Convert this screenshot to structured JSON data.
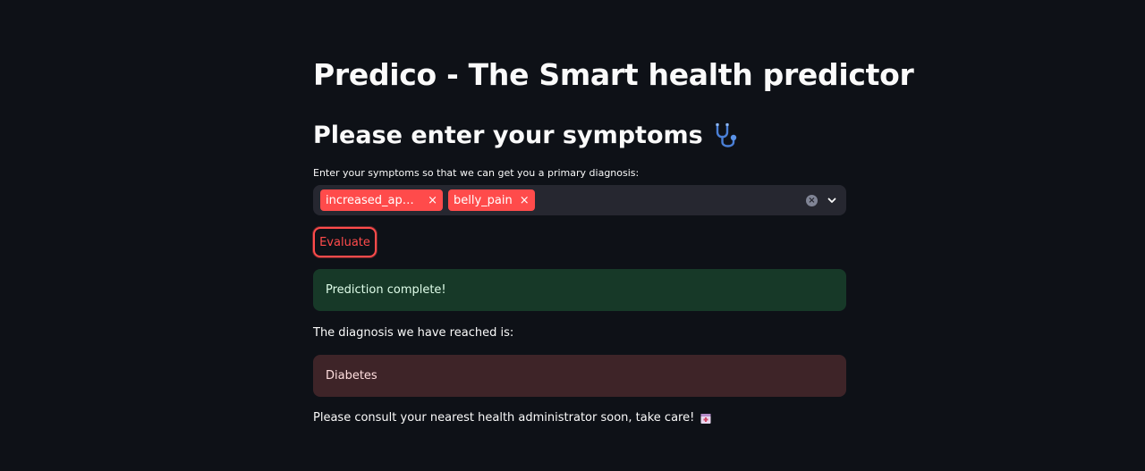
{
  "app": {
    "title": "Predico - The Smart health predictor"
  },
  "form": {
    "heading": "Please enter your symptoms",
    "heading_icon": "stethoscope-icon",
    "label": "Enter your symptoms so that we can get you a primary diagnosis:",
    "selected_symptoms": [
      {
        "label": "increased_appet...",
        "remove": "×"
      },
      {
        "label": "belly_pain",
        "remove": "×"
      }
    ],
    "tag_color": "#ff4b4b",
    "clear_icon": "×",
    "evaluate_label": "Evaluate"
  },
  "result": {
    "success_message": "Prediction complete!",
    "diagnosis_label": "The diagnosis we have reached is:",
    "diagnosis_value": "Diabetes",
    "footer_note": "Please consult your nearest health administrator soon, take care!",
    "footer_icon": "hospital-icon"
  },
  "colors": {
    "background": "#0e1117",
    "accent": "#ff4b4b",
    "success_bg": "#173928",
    "error_bg": "#3e2428"
  }
}
